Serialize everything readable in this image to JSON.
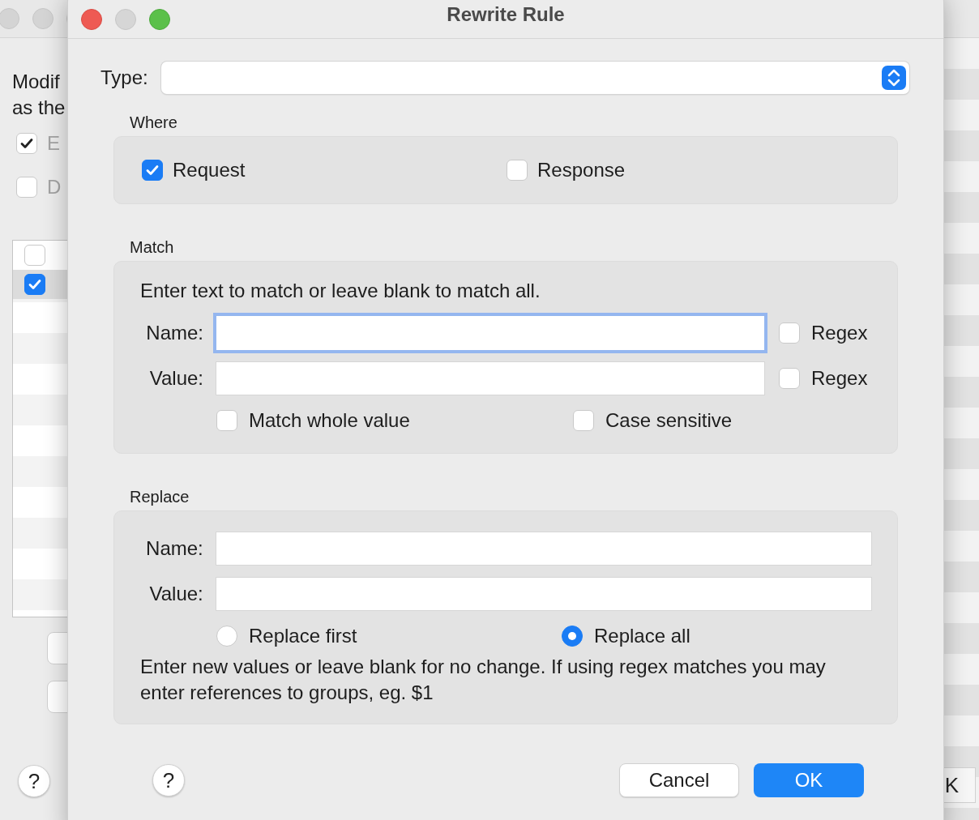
{
  "background_window": {
    "text_1": "Modif",
    "text_2": "as the",
    "options": [
      {
        "label": "E",
        "checked": true
      },
      {
        "label": "D",
        "checked": false
      }
    ],
    "list_rows": [
      {
        "checked": false,
        "selected": false
      },
      {
        "checked": true,
        "selected": true
      }
    ],
    "help": "?",
    "button_text": "K"
  },
  "dialog": {
    "title": "Rewrite Rule",
    "type_label": "Type:",
    "where": {
      "title": "Where",
      "options": [
        {
          "label": "Request",
          "checked": true
        },
        {
          "label": "Response",
          "checked": false
        }
      ]
    },
    "match": {
      "title": "Match",
      "hint": "Enter text to match or leave blank to match all.",
      "fields": [
        {
          "label": "Name:",
          "focused": true,
          "regex": {
            "label": "Regex",
            "checked": false
          }
        },
        {
          "label": "Value:",
          "focused": false,
          "regex": {
            "label": "Regex",
            "checked": false
          }
        }
      ],
      "options": [
        {
          "label": "Match whole value",
          "checked": false
        },
        {
          "label": "Case sensitive",
          "checked": false
        }
      ]
    },
    "replace": {
      "title": "Replace",
      "fields": [
        {
          "label": "Name:"
        },
        {
          "label": "Value:"
        }
      ],
      "modes": [
        {
          "label": "Replace first",
          "selected": false
        },
        {
          "label": "Replace all",
          "selected": true
        }
      ],
      "note": "Enter new values or leave blank for no change. If using regex matches you may enter references to groups, eg. $1"
    },
    "help": "?",
    "buttons": [
      {
        "label": "Cancel",
        "kind": "secondary"
      },
      {
        "label": "OK",
        "kind": "primary"
      }
    ]
  }
}
